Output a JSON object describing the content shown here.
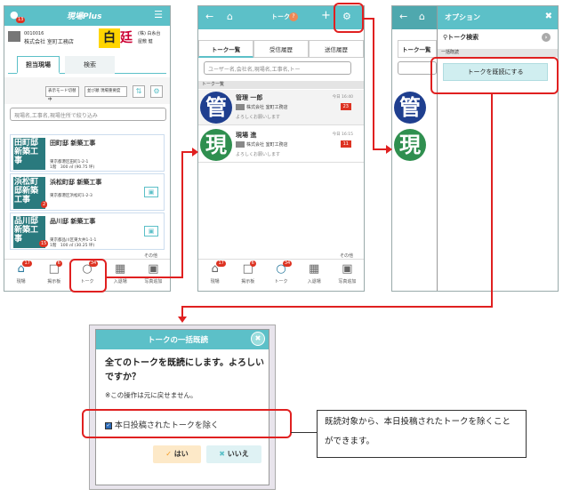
{
  "screen1": {
    "app_title": "現場Plus",
    "menu_icon": "hamburger-icon",
    "user_code": "0010016",
    "user_company": "株式会社 室町工務店",
    "logo_text": "白",
    "logo_text2": "廷",
    "right_company": "(株) 白糸台",
    "right_person": "屋敷 健",
    "bell_badge": "13",
    "tabs": [
      "担当現場",
      "検索"
    ],
    "toolbar_btn1": "表示モード切替",
    "toolbar_btn1_value": "中",
    "toolbar_btn2": "並び順",
    "toolbar_btn2_value": "現場重要度",
    "search_placeholder": "現場名,工事名,現場住所で絞り込み",
    "sites": [
      {
        "thumb": "田町邸新築工事",
        "name": "田町邸 新築工事",
        "addr": "東京都港区田町1-2-1",
        "detail": "1階　300 ㎡ (90.75 坪)",
        "badge": ""
      },
      {
        "thumb": "浜松町邸新築工事",
        "name": "浜松町邸 新築工事",
        "addr": "東京都港区浜松町1-2-3",
        "detail": "",
        "badge": "2"
      },
      {
        "thumb": "品川邸新築工事",
        "name": "品川邸 新築工事",
        "addr": "東京都品川区東大井1-1-1",
        "detail": "1階　100 ㎡ (30.25 坪)",
        "badge": "15"
      }
    ],
    "other": "その他",
    "nav": [
      {
        "label": "現場",
        "icon": "house-icon",
        "badge": "17"
      },
      {
        "label": "掲示板",
        "icon": "board-icon",
        "badge": "6"
      },
      {
        "label": "トーク",
        "icon": "talk-icon",
        "badge": "34"
      },
      {
        "label": "入退場",
        "icon": "entry-icon",
        "badge": ""
      },
      {
        "label": "写真追加",
        "icon": "camera-icon",
        "badge": ""
      }
    ]
  },
  "screen2": {
    "title": "トーク",
    "help": "?",
    "tabs": [
      "トーク一覧",
      "受信履歴",
      "送信履歴"
    ],
    "search_placeholder": "ユーザー名,会社名,現場名,工事名,トー",
    "section": "トーク一覧",
    "talks": [
      {
        "avatar": "管",
        "name": "管理 一郎",
        "company": "株式会社 室町工務店",
        "msg": "よろしくお願いします",
        "time": "今日 16:40",
        "badge": "23"
      },
      {
        "avatar": "現",
        "name": "現場 進",
        "company": "株式会社 室町工務店",
        "msg": "よろしくお願いします",
        "time": "今日 16:15",
        "badge": "11"
      }
    ],
    "other": "その他",
    "nav": [
      {
        "label": "現場",
        "icon": "house-icon",
        "badge": "17"
      },
      {
        "label": "掲示板",
        "icon": "board-icon",
        "badge": "6"
      },
      {
        "label": "トーク",
        "icon": "talk-icon",
        "badge": "34"
      },
      {
        "label": "入退場",
        "icon": "entry-icon",
        "badge": ""
      },
      {
        "label": "写真追加",
        "icon": "camera-icon",
        "badge": ""
      }
    ]
  },
  "screen3": {
    "panel_title": "オプション",
    "search_label": "トーク検索",
    "section": "一括既読",
    "mark_read_button": "トークを既読にする",
    "tab_peek": "トーク一覧",
    "avatars": [
      "管",
      "現"
    ]
  },
  "dialog": {
    "title": "トークの一括既読",
    "message": "全てのトークを既読にします。よろしいですか？",
    "note": "※この操作は元に戻せません。",
    "checkbox_label": "本日投稿されたトークを除く",
    "yes_label": "はい",
    "no_label": "いいえ"
  },
  "callout": {
    "text": "既読対象から、本日投稿されたトークを除くことができます。"
  },
  "colors": {
    "accent": "#5cc0c8",
    "highlight": "#e02020",
    "badge": "#d32f2f"
  }
}
